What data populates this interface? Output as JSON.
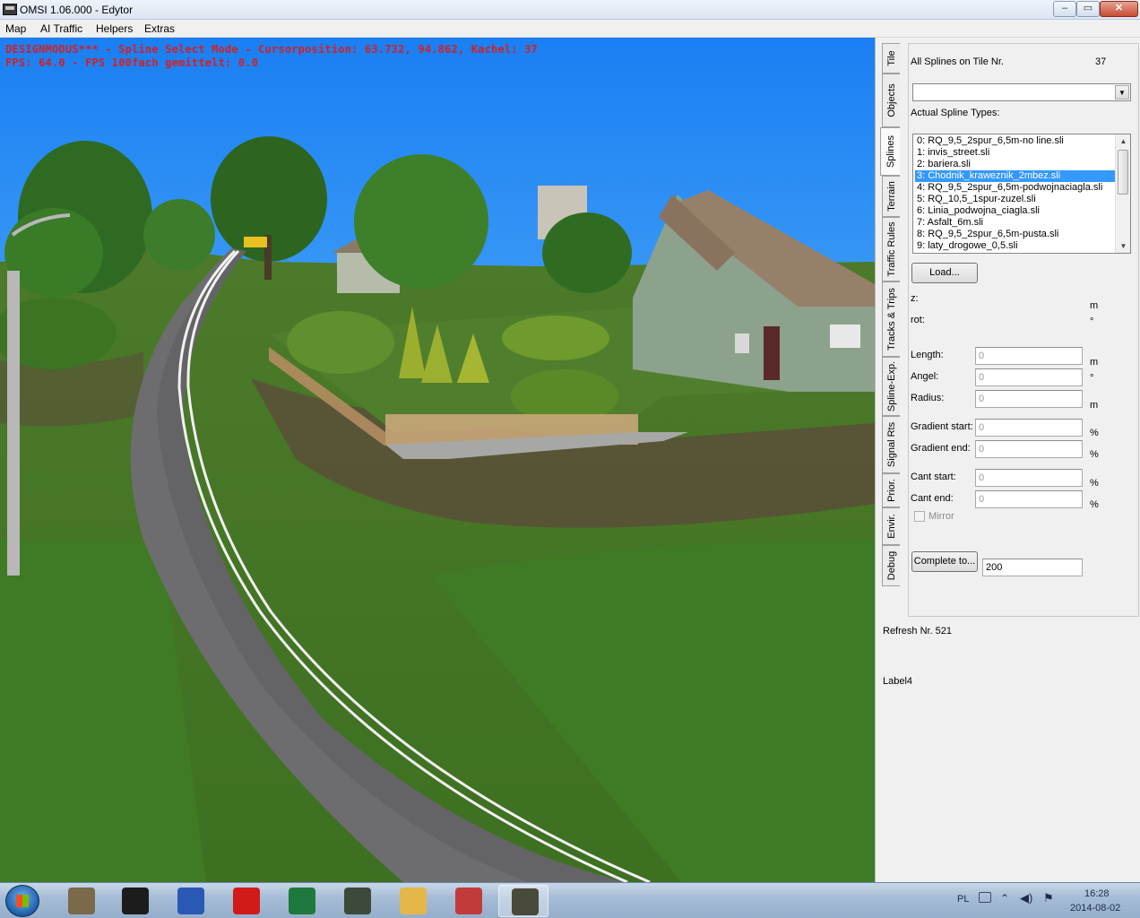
{
  "window": {
    "title": "OMSI 1.06.000 - Edytor",
    "min_glyph": "‒",
    "max_glyph": "▭",
    "close_glyph": "✕"
  },
  "menu": [
    "Map",
    "AI Traffic",
    "Helpers",
    "Extras"
  ],
  "viewport": {
    "status_line1": "DESIGNMODUS*** - Spline Select Mode - Cursorposition: 63.732, 94.862, Kachel: 37",
    "status_line2": "FPS: 64.0 - FPS 100fach gemittelt: 0.0"
  },
  "tabs": [
    {
      "label": "Tile",
      "active": false
    },
    {
      "label": "Objects",
      "active": false
    },
    {
      "label": "Splines",
      "active": true
    },
    {
      "label": "Terrain",
      "active": false
    },
    {
      "label": "Traffic Rules",
      "active": false
    },
    {
      "label": "Tracks & Trips",
      "active": false
    },
    {
      "label": "Spline-Exp.",
      "active": false
    },
    {
      "label": "Signal Rts",
      "active": false
    },
    {
      "label": "Prior.",
      "active": false
    },
    {
      "label": "Envir.",
      "active": false
    },
    {
      "label": "Debug",
      "active": false
    }
  ],
  "splines": {
    "all_on_tile_label": "All Splines on Tile Nr.",
    "tile_number": "37",
    "combo_value": "",
    "actual_types_label": "Actual Spline Types:",
    "types": [
      "0: RQ_9,5_2spur_6,5m-no line.sli",
      "1: invis_street.sli",
      "2: bariera.sli",
      "3: Chodnik_kraweznik_2mbez.sli",
      "4: RQ_9,5_2spur_6,5m-podwojnaciagla.sli",
      "5: RQ_10,5_1spur-zuzel.sli",
      "6: Linia_podwojna_ciagla.sli",
      "7: Asfalt_6m.sli",
      "8: RQ_9,5_2spur_6,5m-pusta.sli",
      "9: laty_drogowe_0,5.sli"
    ],
    "selected_index": 3,
    "load_button": "Load...",
    "z_label": "z:",
    "z_unit": "m",
    "rot_label": "rot:",
    "rot_unit": "°",
    "fields": [
      {
        "label": "Length:",
        "value": "0",
        "unit": "m"
      },
      {
        "label": "Angel:",
        "value": "0",
        "unit": "°"
      },
      {
        "label": "Radius:",
        "value": "0",
        "unit": "m"
      },
      {
        "label": "Gradient start:",
        "value": "0",
        "unit": "%"
      },
      {
        "label": "Gradient end:",
        "value": "0",
        "unit": "%"
      },
      {
        "label": "Cant start:",
        "value": "0",
        "unit": "%"
      },
      {
        "label": "Cant end:",
        "value": "0",
        "unit": "%"
      }
    ],
    "mirror_label": "Mirror",
    "mirror_checked": false,
    "complete_button": "Complete to...",
    "complete_value": "200"
  },
  "refresh_label": "Refresh Nr. 521",
  "label4": "Label4",
  "taskbar": {
    "apps": [
      {
        "name": "gimp-icon",
        "color": "#7a6a4a",
        "active": false
      },
      {
        "name": "spotify-icon",
        "color": "#1c1c1c",
        "active": false
      },
      {
        "name": "devcpp-icon",
        "color": "#2a58b5",
        "active": false
      },
      {
        "name": "opera-icon",
        "color": "#d11a1a",
        "active": false
      },
      {
        "name": "excel-icon",
        "color": "#1e7a3c",
        "active": false
      },
      {
        "name": "monitor-icon",
        "color": "#3c4a3a",
        "active": false
      },
      {
        "name": "explorer-icon",
        "color": "#e3b848",
        "active": false
      },
      {
        "name": "molecule-icon",
        "color": "#c23b3b",
        "active": false
      },
      {
        "name": "omsi-icon",
        "color": "#4a4a3a",
        "active": true
      }
    ],
    "language": "PL",
    "time": "16:28",
    "date": "2014-08-02"
  }
}
